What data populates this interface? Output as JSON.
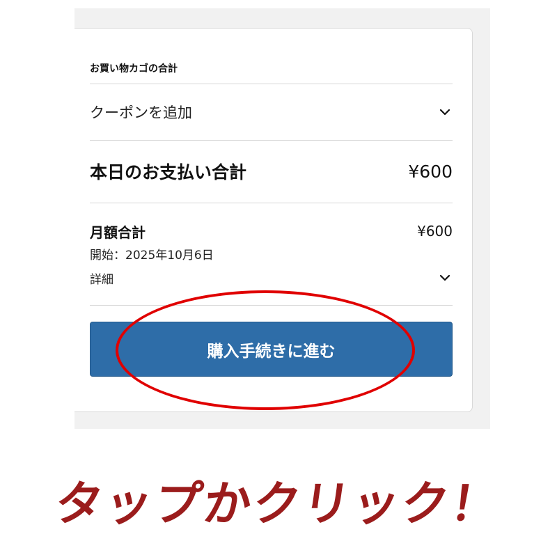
{
  "cart": {
    "title": "お買い物カゴの合計",
    "coupon": {
      "label": "クーポンを追加",
      "icon": "chevron-down-icon"
    },
    "today_total": {
      "label": "本日のお支払い合計",
      "amount": "¥600"
    },
    "monthly": {
      "label": "月額合計",
      "amount": "¥600",
      "start": "開始：2025年10月6日",
      "details_label": "詳細",
      "icon": "chevron-down-icon"
    },
    "checkout_button": {
      "label": "購入手続きに進む",
      "color": "#2e6da8"
    }
  },
  "annotation": {
    "callout_text": "タップかクリック！",
    "highlight_color": "#e00000",
    "callout_color": "#9b1c1c"
  }
}
